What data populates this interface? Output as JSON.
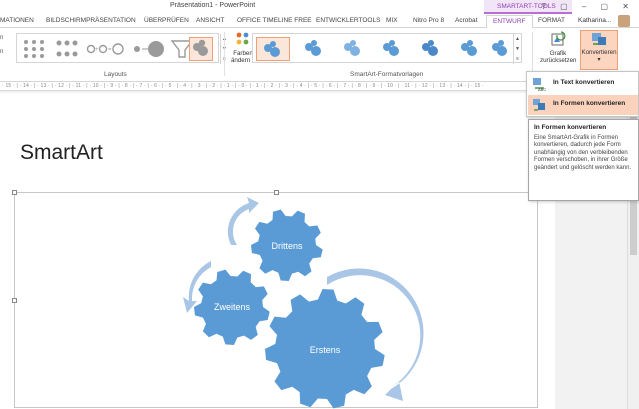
{
  "window": {
    "title": "Präsentation1 - PowerPoint",
    "contextual_tab_group": "SMARTART-TOOLS",
    "window_buttons": "? ▢ – ▢ ✕"
  },
  "tabs": [
    {
      "label": "MATIONEN"
    },
    {
      "label": "BILDSCHIRMPRÄSENTATION"
    },
    {
      "label": "ÜBERPRÜFEN"
    },
    {
      "label": "ANSICHT"
    },
    {
      "label": "OFFICE TIMELINE FREE"
    },
    {
      "label": "ENTWICKLERTOOLS"
    },
    {
      "label": "MIX"
    },
    {
      "label": "Nitro Pro 8"
    },
    {
      "label": "Acrobat"
    },
    {
      "label": "ENTWURF"
    },
    {
      "label": "FORMAT"
    }
  ],
  "user": {
    "name": "Katharina..."
  },
  "ribbon": {
    "layouts_group_label": "Layouts",
    "styles_group_label": "SmartArt-Formatvorlagen",
    "left_snippet_top": "n",
    "left_snippet_bottom": "n",
    "change_colors": {
      "line1": "Farben",
      "line2": "ändern ▾"
    },
    "reset_graphic": {
      "line1": "Grafik",
      "line2": "zurücksetzen"
    },
    "convert": {
      "line1": "Konvertieren",
      "line2": "▾"
    }
  },
  "ruler": {
    "text": "· 15 · | · 14 · | · 13 · | · 12 · | · 11 · | · 10 · | · 9 · | · 8 · | · 7 · | · 6 · | · 5 · | · 4 · | · 3 · | · 2 · | · 1 · | · 0 · | · 1 · | · 2 · | · 3 · | · 4 · | · 5 · | · 6 · | · 7 · | · 8 · | · 9 · | · 10 · | · 11 · | · 12 · | · 13 · | · 14 · | · 15 ·"
  },
  "slide": {
    "title": "SmartArt",
    "gears": [
      {
        "label": "Erstens"
      },
      {
        "label": "Zweitens"
      },
      {
        "label": "Drittens"
      }
    ]
  },
  "colors": {
    "gear_fill": "#5b9bd5",
    "arrow_fill": "#a9c6e6",
    "accent_purple": "#8e3fb0",
    "menu_highlight": "#fbd3bd"
  },
  "convert_menu": {
    "items": [
      {
        "label": "In Text konvertieren",
        "icon": "convert-to-text-icon"
      },
      {
        "label": "In Formen konvertieren",
        "icon": "convert-to-shapes-icon",
        "highlighted": true
      }
    ]
  },
  "tooltip": {
    "title": "In Formen konvertieren",
    "body": "Eine SmartArt-Grafik in Formen konvertieren, dadurch jede Form unabhängig von den verbleibenden Formen verschoben, in ihrer Größe geändert und gelöscht werden kann."
  }
}
